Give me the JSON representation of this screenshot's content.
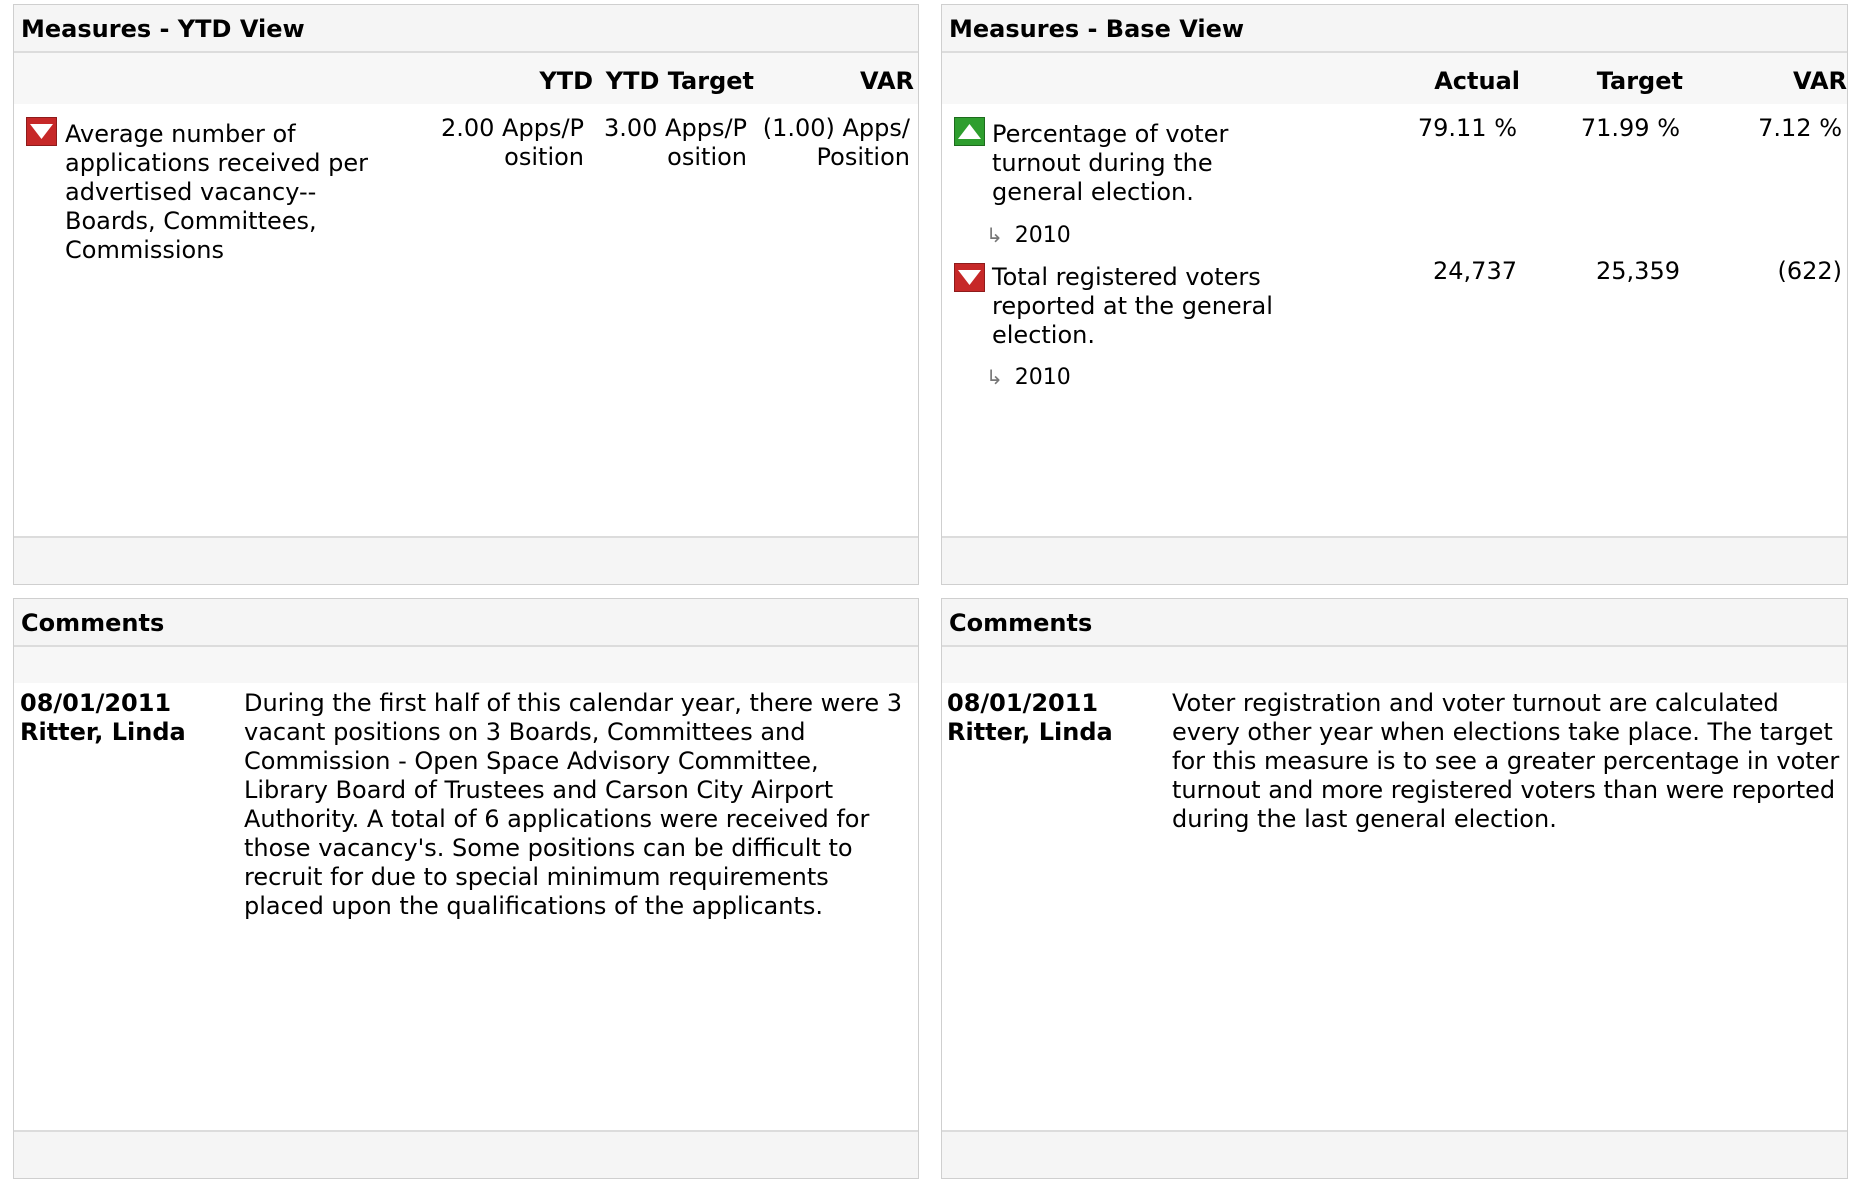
{
  "ytd_panel": {
    "title": "Measures - YTD View",
    "columns": [
      "YTD",
      "YTD Target",
      "VAR"
    ],
    "measure": {
      "status": "down",
      "name": "Average number of applications received per advertised vacancy--Boards, Committees, Commissions",
      "ytd": "2.00 Apps/Position",
      "ytd_target": "3.00 Apps/Position",
      "var": "(1.00) Apps/Position"
    }
  },
  "base_panel": {
    "title": "Measures - Base View",
    "columns": [
      "Actual",
      "Target",
      "VAR"
    ],
    "measures": [
      {
        "status": "up",
        "name": "Percentage of voter turnout during the general election.",
        "period": "2010",
        "actual": "79.11 %",
        "target": "71.99 %",
        "var": "7.12 %"
      },
      {
        "status": "down",
        "name": "Total registered voters reported at the general election.",
        "period": "2010",
        "actual": "24,737",
        "target": "25,359",
        "var": "(622)"
      }
    ]
  },
  "comments_left": {
    "title": "Comments",
    "date": "08/01/2011",
    "author": "Ritter, Linda",
    "text": "During the first half of this calendar year, there were 3 vacant positions on 3 Boards, Committees and Commission - Open Space Advisory Committee, Library Board of Trustees and Carson City Airport Authority. A total of 6 applications were received for those vacancy's. Some positions can be difficult to recruit for due to special minimum requirements placed upon the qualifications of the applicants."
  },
  "comments_right": {
    "title": "Comments",
    "date": "08/01/2011",
    "author": "Ritter, Linda",
    "text": "Voter registration and voter turnout are calculated every other year when elections take place. The target for this measure is to see a greater percentage in voter turnout and more registered voters than were reported during the last general election."
  },
  "colors": {
    "status_down": "#c62828",
    "status_up": "#2e9e2e"
  },
  "icons": {
    "status_down": "down-triangle-icon",
    "status_up": "up-triangle-icon",
    "sub_period": "return-arrow-icon"
  }
}
